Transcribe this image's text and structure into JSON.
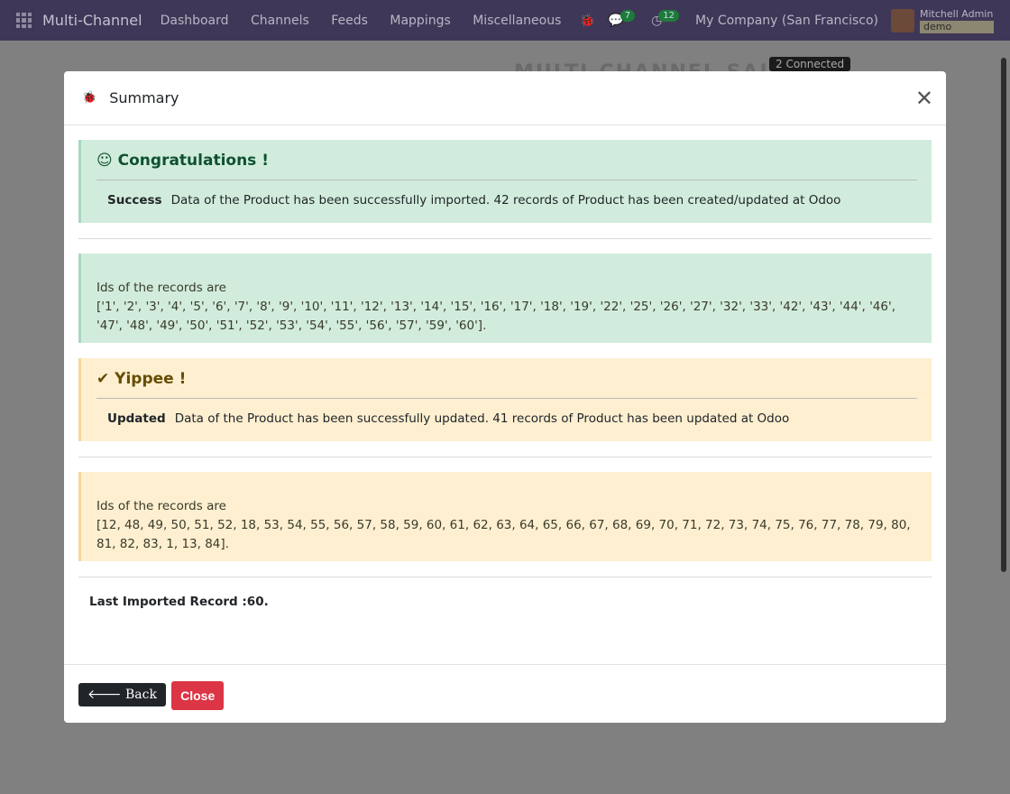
{
  "nav": {
    "brand": "Multi-Channel",
    "menu": [
      "Dashboard",
      "Channels",
      "Feeds",
      "Mappings",
      "Miscellaneous"
    ],
    "messages_count": "7",
    "activities_count": "12",
    "company": "My Company (San Francisco)",
    "user": "Mitchell Admin",
    "database": "demo"
  },
  "background": {
    "title": "MULTI-CHANNEL SALE",
    "connected": "2 Connected"
  },
  "modal": {
    "title": "Summary",
    "success": {
      "heading": "Congratulations !",
      "label": "Success",
      "message": "Data of the Product has been successfully imported. 42 records of Product has been created/updated at Odoo",
      "ids_label": "Ids of the records are",
      "ids": "['1', '2', '3', '4', '5', '6', '7', '8', '9', '10', '11', '12', '13', '14', '15', '16', '17', '18', '19', '22', '25', '26', '27', '32', '33', '42', '43', '44', '46', '47', '48', '49', '50', '51', '52', '53', '54', '55', '56', '57', '59', '60']."
    },
    "updated": {
      "heading": "Yippee !",
      "label": "Updated",
      "message": "Data of the Product has been successfully updated. 41 records of Product has been updated at Odoo",
      "ids_label": "Ids of the records are",
      "ids": "[12, 48, 49, 50, 51, 52, 18, 53, 54, 55, 56, 57, 58, 59, 60, 61, 62, 63, 64, 65, 66, 67, 68, 69, 70, 71, 72, 73, 74, 75, 76, 77, 78, 79, 80, 81, 82, 83, 1, 13, 84]."
    },
    "last_imported": "Last Imported Record :60.",
    "back_label": "Back",
    "close_label": "Close"
  }
}
